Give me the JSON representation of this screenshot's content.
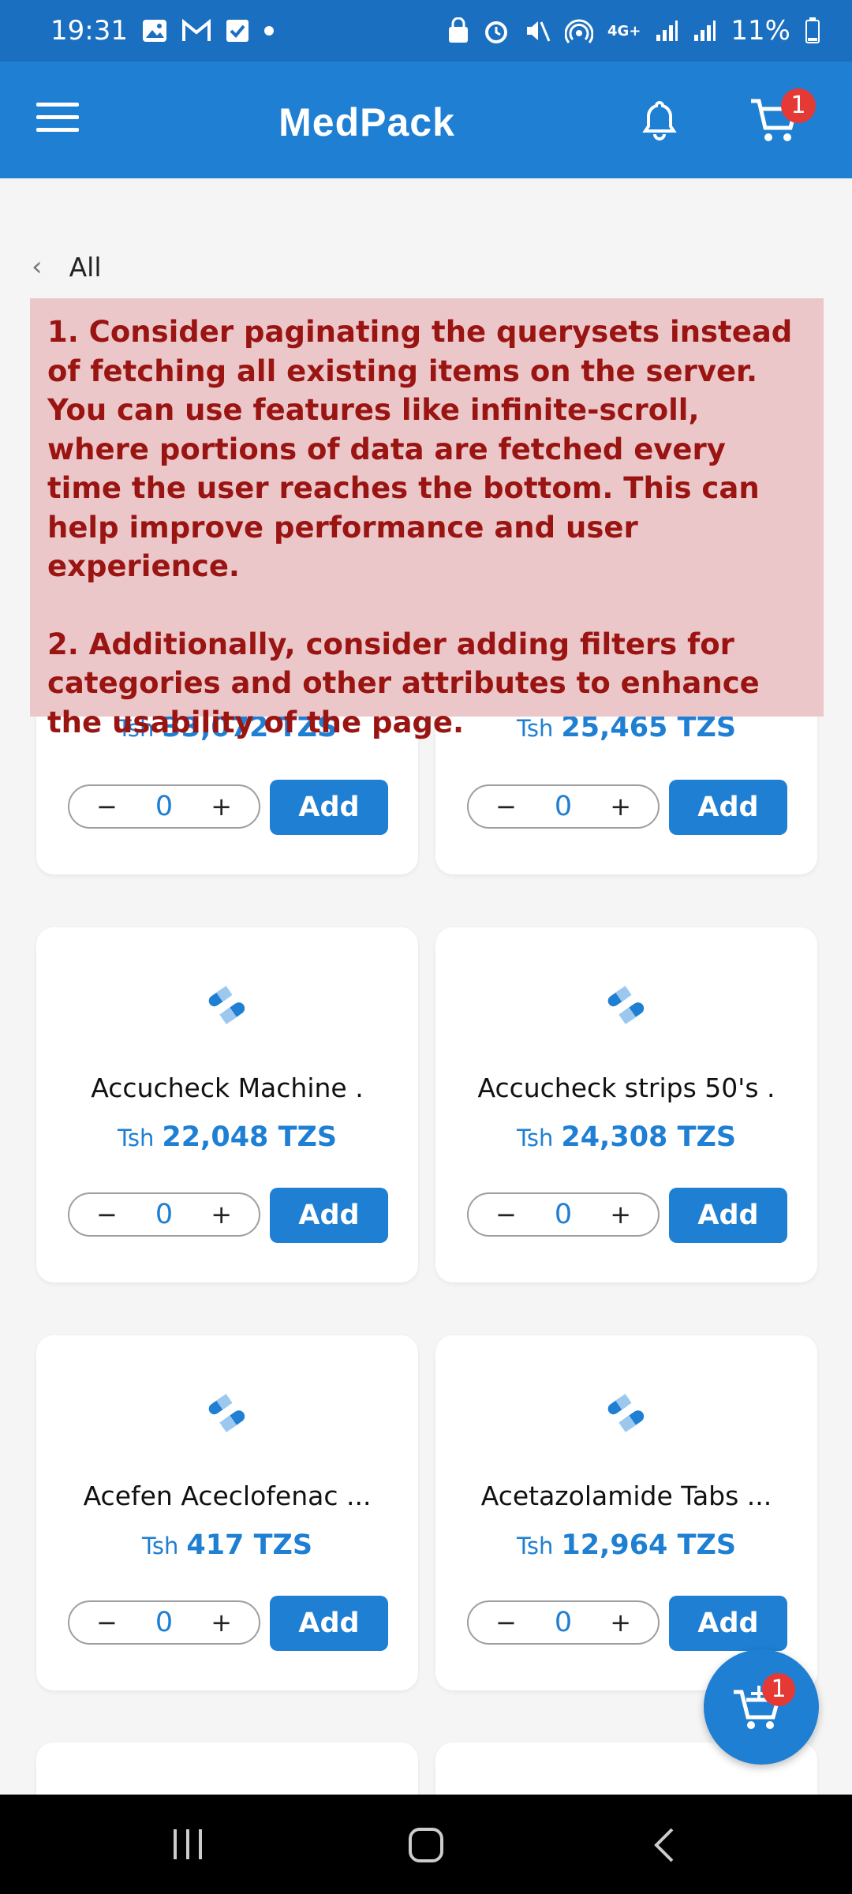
{
  "status_bar": {
    "time": "19:31",
    "battery": "11%",
    "network": "4G+"
  },
  "app_bar": {
    "title": "MedPack",
    "cart_badge": "1"
  },
  "breadcrumb": {
    "label": "All"
  },
  "review_note": {
    "paragraph_1": "1. Consider paginating the querysets instead of fetching all existing items on the server. You can use features like infinite-scroll, where portions of data are fetched every time the user reaches the bottom. This can help improve performance and user experience.",
    "paragraph_2": "2. Additionally, consider adding filters for categories and other attributes to enhance the usability of the page."
  },
  "products": [
    {
      "name": "",
      "currency": "Tsh",
      "price": "33,072 TZS",
      "qty": "0",
      "add_label": "Add"
    },
    {
      "name": "",
      "currency": "Tsh",
      "price": "25,465 TZS",
      "qty": "0",
      "add_label": "Add"
    },
    {
      "name": "Accucheck Machine .",
      "currency": "Tsh",
      "price": "22,048 TZS",
      "qty": "0",
      "add_label": "Add"
    },
    {
      "name": "Accucheck strips 50's .",
      "currency": "Tsh",
      "price": "24,308 TZS",
      "qty": "0",
      "add_label": "Add"
    },
    {
      "name": "Acefen Aceclofenac ...",
      "currency": "Tsh",
      "price": "417 TZS",
      "qty": "0",
      "add_label": "Add"
    },
    {
      "name": "Acetazolamide Tabs ...",
      "currency": "Tsh",
      "price": "12,964 TZS",
      "qty": "0",
      "add_label": "Add"
    }
  ],
  "stepper": {
    "minus": "−",
    "plus": "+"
  },
  "fab": {
    "badge": "1"
  },
  "colors": {
    "primary": "#1e7fd3",
    "status_bar": "#1b6fc0",
    "badge": "#e53935",
    "review_bg": "#ebc7ca",
    "review_text": "#9a1412"
  }
}
